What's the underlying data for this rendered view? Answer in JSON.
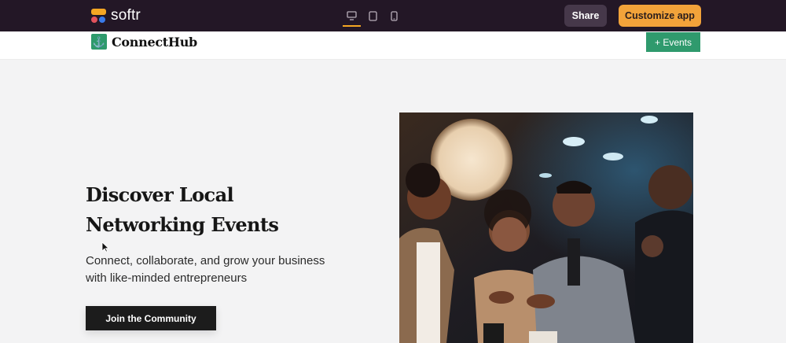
{
  "editor": {
    "logo_text": "softr",
    "devices": [
      {
        "icon": "desktop-icon",
        "active": true
      },
      {
        "icon": "tablet-icon",
        "active": false
      },
      {
        "icon": "mobile-icon",
        "active": false
      }
    ],
    "share_label": "Share",
    "customize_label": "Customize app"
  },
  "site": {
    "brand_icon": "anchor-icon",
    "brand_glyph": "⚓",
    "brand_name": "ConnectHub",
    "events_button": "+ Events"
  },
  "hero": {
    "title": "Discover Local Networking Events",
    "subtitle": "Connect, collaborate, and grow your business with like-minded entrepreneurs",
    "cta_label": "Join the Community",
    "image": "networking-people-photo"
  },
  "colors": {
    "editor_bar": "#231726",
    "accent_orange": "#f2a33a",
    "brand_green": "#2f9a6d",
    "page_bg": "#f3f3f4"
  }
}
